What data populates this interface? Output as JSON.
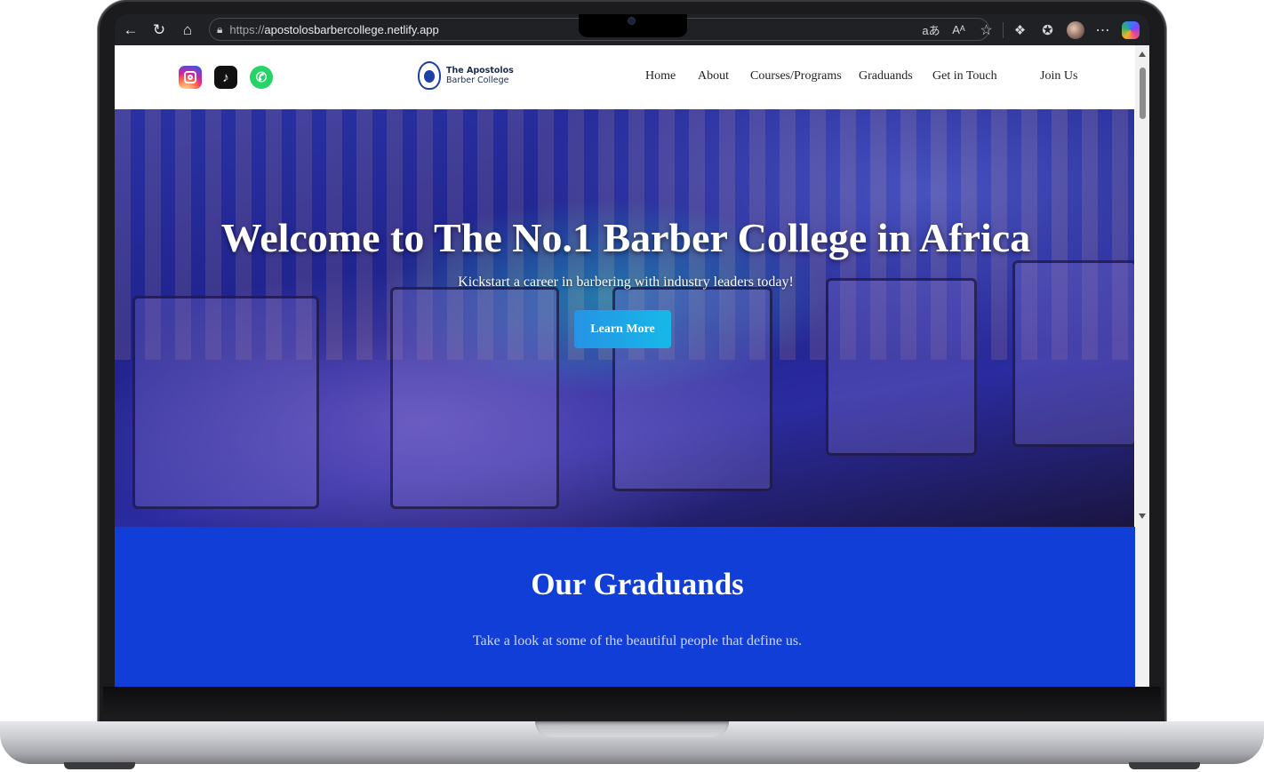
{
  "browser": {
    "url_protocol": "https://",
    "url_host": "apostolosbarbercollege.netlify.app",
    "read_aloud_label": "Aᴬ",
    "translate_label": "aあ"
  },
  "header": {
    "logo_line1": "The Apostolos",
    "logo_line2": "Barber College",
    "nav": {
      "home": "Home",
      "about": "About",
      "courses": "Courses/Programs",
      "graduands": "Graduands",
      "contact": "Get in Touch",
      "join": "Join Us"
    },
    "social": [
      "instagram-icon",
      "tiktok-icon",
      "whatsapp-icon"
    ]
  },
  "hero": {
    "title": "Welcome to The No.1 Barber College in Africa",
    "subtitle": "Kickstart a career in barbering with industry leaders today!",
    "cta_label": "Learn More"
  },
  "graduands": {
    "title": "Our Graduands",
    "subtitle": "Take a look at some of the beautiful people that define us."
  },
  "colors": {
    "accent_blue": "#123ed8",
    "cta_gradient_start": "#2693e6",
    "cta_gradient_end": "#16b8e8"
  }
}
